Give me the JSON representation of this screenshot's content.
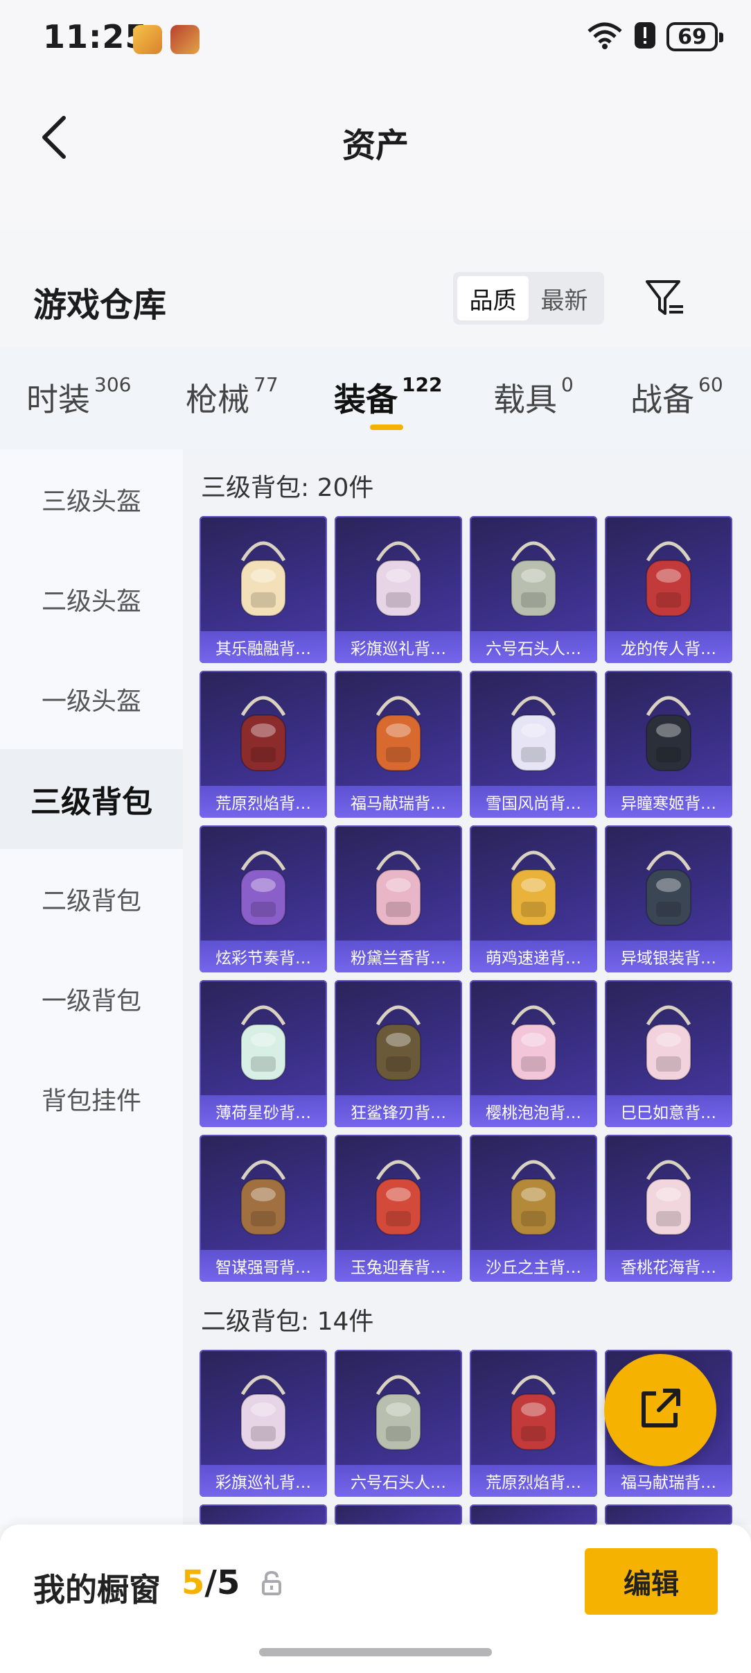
{
  "status_bar": {
    "time": "11:25",
    "battery": "69"
  },
  "header": {
    "title": "资产"
  },
  "repository": {
    "title": "游戏仓库",
    "sort_options": [
      "品质",
      "最新"
    ],
    "active_sort": "品质"
  },
  "tabs": [
    {
      "label": "时装",
      "count": "306"
    },
    {
      "label": "枪械",
      "count": "77"
    },
    {
      "label": "装备",
      "count": "122",
      "active": true
    },
    {
      "label": "载具",
      "count": "0"
    },
    {
      "label": "战备",
      "count": "60"
    }
  ],
  "sidebar": {
    "items": [
      {
        "label": "三级头盔"
      },
      {
        "label": "二级头盔"
      },
      {
        "label": "一级头盔"
      },
      {
        "label": "三级背包",
        "active": true
      },
      {
        "label": "二级背包"
      },
      {
        "label": "一级背包"
      },
      {
        "label": "背包挂件"
      }
    ]
  },
  "sections": [
    {
      "title": "三级背包: 20件",
      "items": [
        {
          "name": "其乐融融背…",
          "icon": "cream-puff-backpack"
        },
        {
          "name": "彩旗巡礼背…",
          "icon": "pastel-bow-backpack"
        },
        {
          "name": "六号石头人…",
          "icon": "stone-golem-backpack"
        },
        {
          "name": "龙的传人背…",
          "icon": "red-school-backpack"
        },
        {
          "name": "荒原烈焰背…",
          "icon": "crimson-armor-backpack"
        },
        {
          "name": "福马献瑞背…",
          "icon": "orange-horse-backpack"
        },
        {
          "name": "雪国风尚背…",
          "icon": "snow-bird-backpack"
        },
        {
          "name": "异瞳寒姬背…",
          "icon": "bunny-ear-backpack"
        },
        {
          "name": "炫彩节奏背…",
          "icon": "graffiti-backpack"
        },
        {
          "name": "粉黛兰香背…",
          "icon": "pink-orb-backpack"
        },
        {
          "name": "萌鸡速递背…",
          "icon": "chick-backpack"
        },
        {
          "name": "异域银装背…",
          "icon": "tech-frame-backpack"
        },
        {
          "name": "薄荷星砂背…",
          "icon": "mint-lace-backpack"
        },
        {
          "name": "狂鲨锋刃背…",
          "icon": "shark-backpack"
        },
        {
          "name": "樱桃泡泡背…",
          "icon": "pink-bow-backpack"
        },
        {
          "name": "巳巳如意背…",
          "icon": "pink-plush-backpack"
        },
        {
          "name": "智谋强哥背…",
          "icon": "brown-plush-backpack"
        },
        {
          "name": "玉兔迎春背…",
          "icon": "red-white-backpack"
        },
        {
          "name": "沙丘之主背…",
          "icon": "scroll-backpack"
        },
        {
          "name": "香桃花海背…",
          "icon": "lace-bow-backpack"
        }
      ]
    },
    {
      "title": "二级背包: 14件",
      "items": [
        {
          "name": "彩旗巡礼背…",
          "icon": "pastel-bow-backpack"
        },
        {
          "name": "六号石头人…",
          "icon": "stone-golem-backpack"
        },
        {
          "name": "荒原烈焰背…",
          "icon": "crimson-armor-backpack"
        },
        {
          "name": "福马献瑞背…",
          "icon": "orange-horse-backpack"
        }
      ]
    }
  ],
  "share_button": {
    "icon": "share-external-icon"
  },
  "bottom_bar": {
    "label": "我的橱窗",
    "current": "5",
    "separator": "/",
    "total": "5",
    "edit_label": "编辑"
  }
}
